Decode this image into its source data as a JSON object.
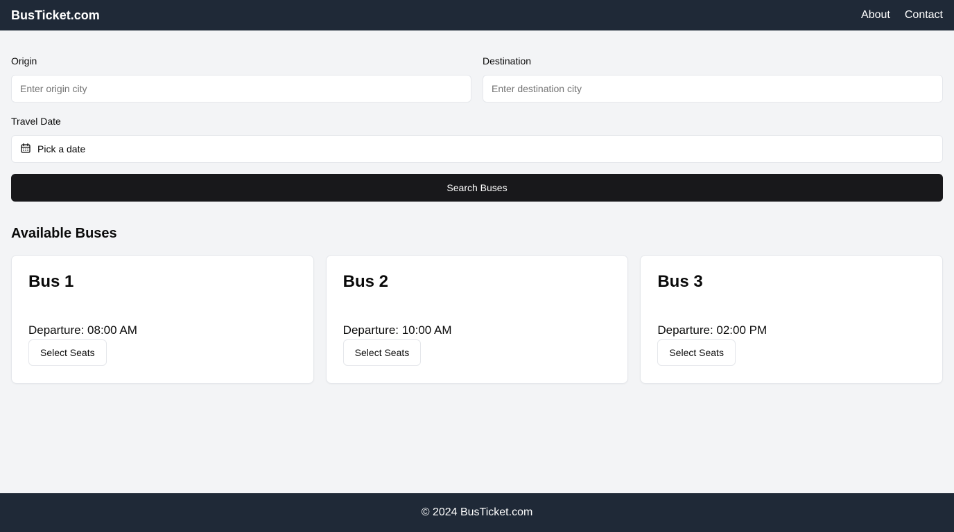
{
  "header": {
    "brand": "BusTicket.com",
    "nav": [
      "About",
      "Contact"
    ]
  },
  "search": {
    "origin_label": "Origin",
    "origin_placeholder": "Enter origin city",
    "origin_value": "",
    "destination_label": "Destination",
    "destination_placeholder": "Enter destination city",
    "destination_value": "",
    "date_label": "Travel Date",
    "date_value": "Pick a date",
    "date_icon": "calendar-icon",
    "submit_label": "Search Buses"
  },
  "results": {
    "title": "Available Buses",
    "buses": [
      {
        "name": "Bus 1",
        "departure": "Departure: 08:00 AM",
        "action": "Select Seats"
      },
      {
        "name": "Bus 2",
        "departure": "Departure: 10:00 AM",
        "action": "Select Seats"
      },
      {
        "name": "Bus 3",
        "departure": "Departure: 02:00 PM",
        "action": "Select Seats"
      }
    ]
  },
  "footer": {
    "text": "© 2024 BusTicket.com"
  },
  "colors": {
    "header_bg": "#1f2937",
    "page_bg": "#f3f4f6",
    "primary_button": "#18181b"
  }
}
